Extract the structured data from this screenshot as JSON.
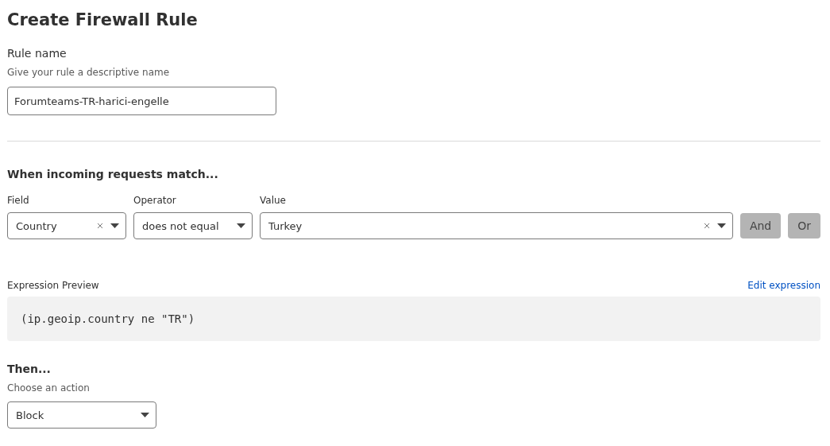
{
  "title": "Create Firewall Rule",
  "rule_name": {
    "label": "Rule name",
    "hint": "Give your rule a descriptive name",
    "value": "Forumteams-TR-harici-engelle"
  },
  "match": {
    "heading": "When incoming requests match...",
    "fields": [
      {
        "label": "Field",
        "value": "Country",
        "clearable": true
      },
      {
        "label": "Operator",
        "value": "does not equal",
        "clearable": false
      },
      {
        "label": "Value",
        "value": "Turkey",
        "clearable": true
      }
    ],
    "buttons": [
      {
        "label": "And",
        "disabled": true
      },
      {
        "label": "Or",
        "disabled": true
      }
    ]
  },
  "expression": {
    "label": "Expression Preview",
    "link": "Edit expression",
    "code": "(ip.geoip.country ne \"TR\")"
  },
  "then": {
    "heading": "Then...",
    "hint": "Choose an action",
    "value": "Block"
  }
}
